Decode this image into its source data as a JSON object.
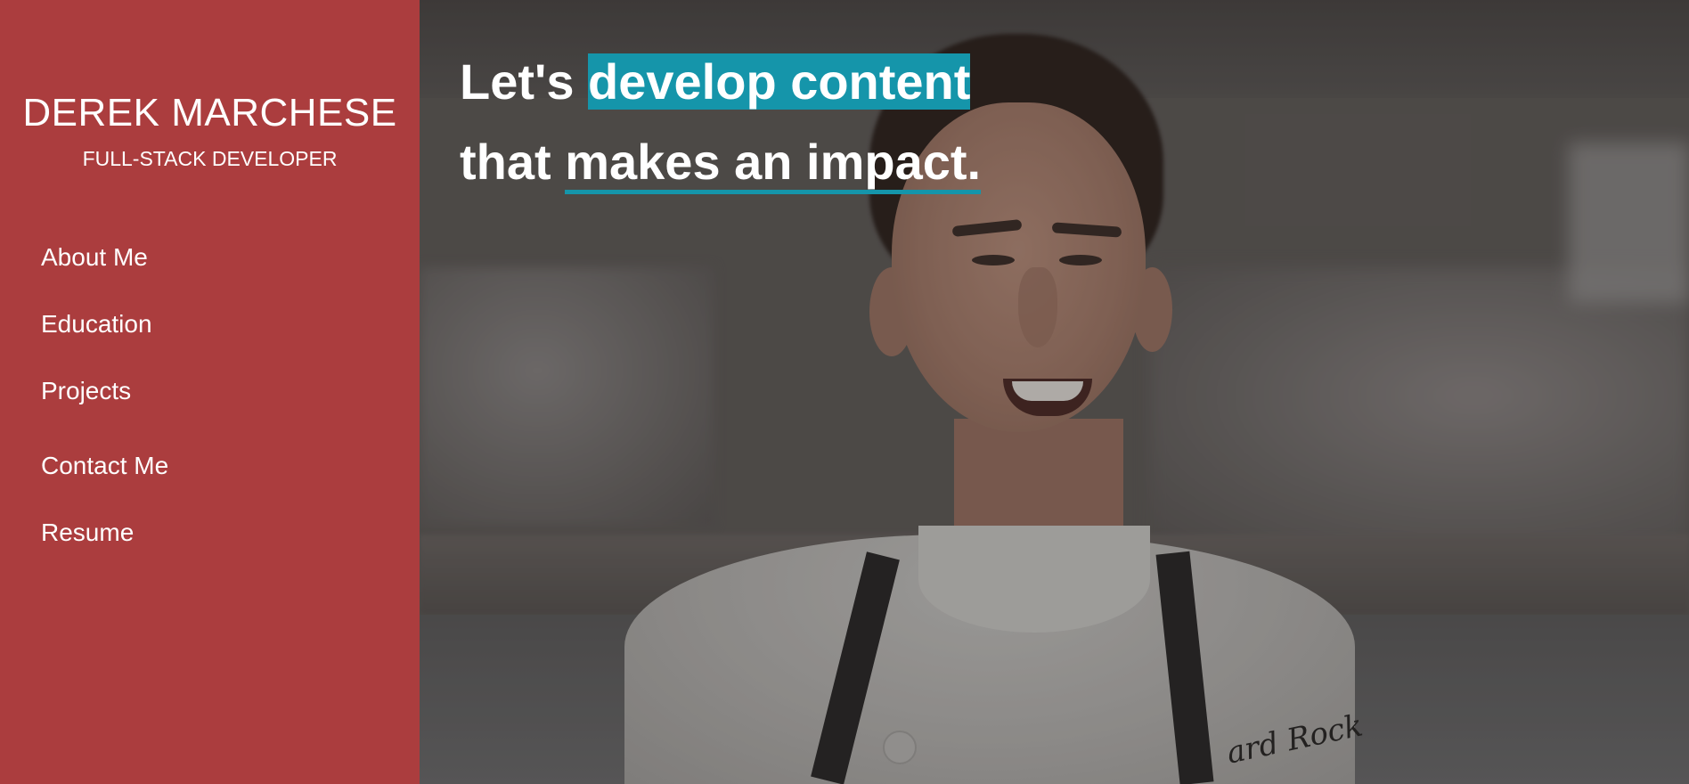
{
  "sidebar": {
    "name": "DEREK MARCHESE",
    "role": "FULL-STACK DEVELOPER",
    "nav": [
      {
        "label": "About Me"
      },
      {
        "label": "Education"
      },
      {
        "label": "Projects"
      },
      {
        "label": "Contact Me"
      },
      {
        "label": "Resume"
      }
    ]
  },
  "hero": {
    "line1_prefix": "Let's ",
    "line1_highlight": "develop content",
    "line2_prefix": "that ",
    "line2_underline": "makes an impact.",
    "logo_text": "ard Rock"
  },
  "colors": {
    "sidebar_bg": "#ab3d3e",
    "accent": "#1595aa",
    "text": "#ffffff"
  }
}
